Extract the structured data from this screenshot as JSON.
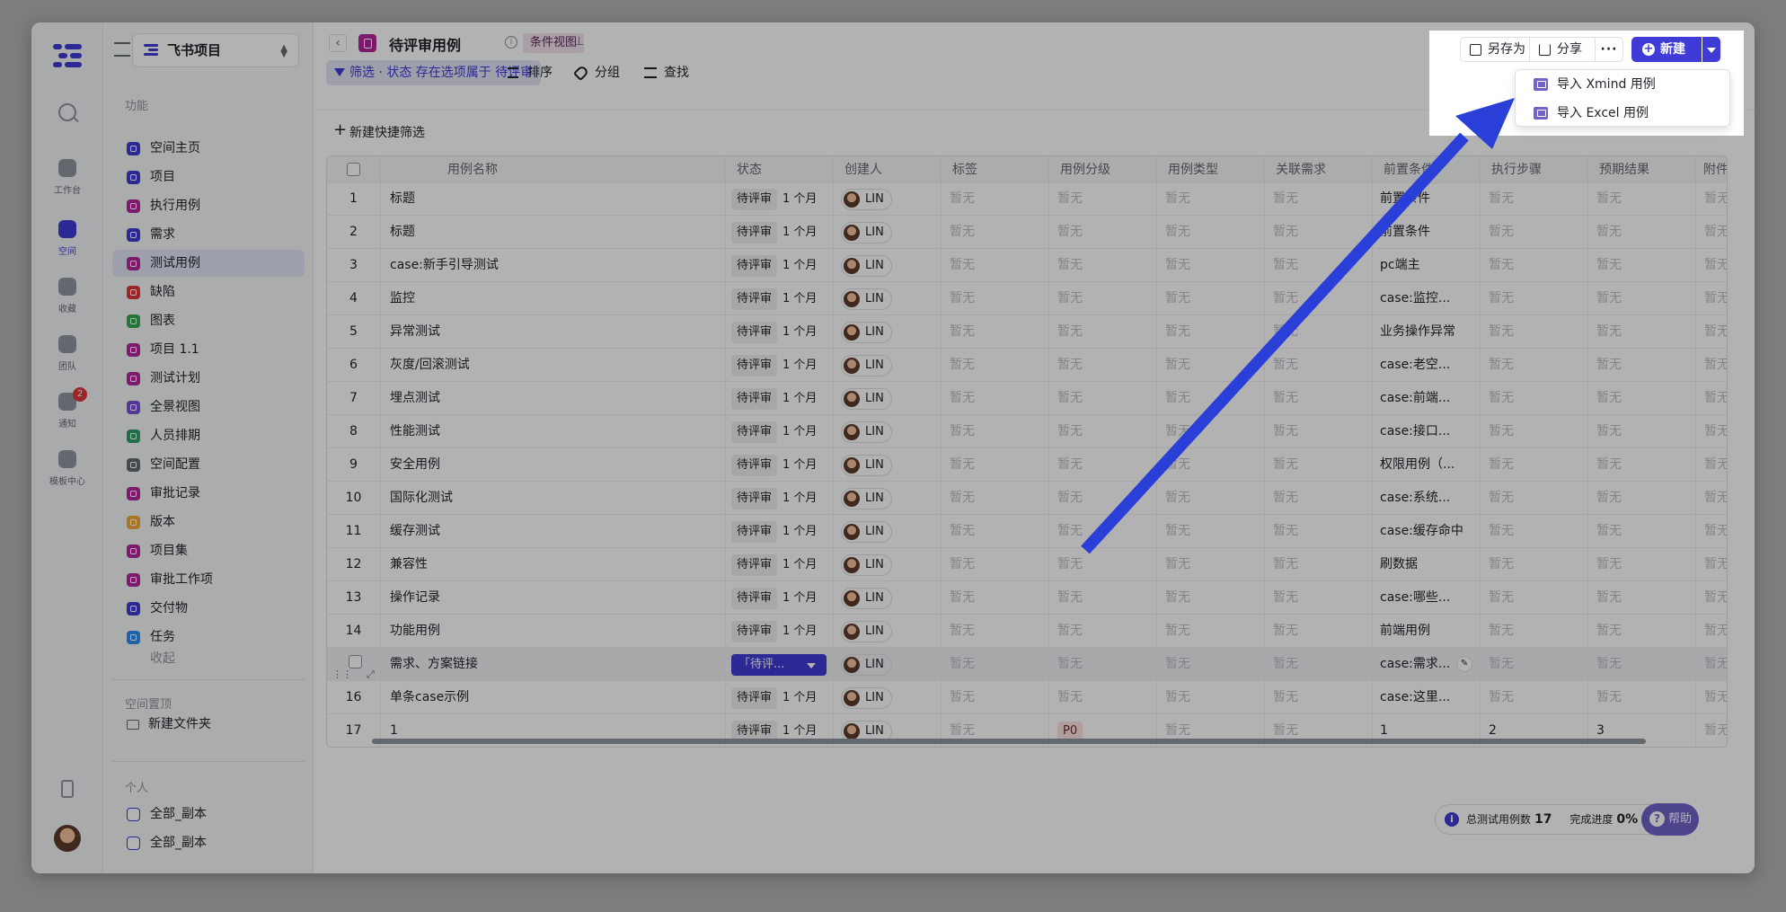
{
  "window": {
    "title": "待评审用例"
  },
  "rail": {
    "items": [
      {
        "label": "工作台"
      },
      {
        "label": "空间"
      },
      {
        "label": "收藏"
      },
      {
        "label": "团队"
      },
      {
        "label": "通知",
        "badge": "2"
      },
      {
        "label": "模板中心"
      }
    ]
  },
  "sidebar": {
    "project": "飞书项目",
    "section_features": "功能",
    "items": [
      {
        "label": "空间主页",
        "color": "#3f3bd6"
      },
      {
        "label": "项目",
        "color": "#3f3bd6"
      },
      {
        "label": "执行用例",
        "color": "#b3269b"
      },
      {
        "label": "需求",
        "color": "#3f3bd6"
      },
      {
        "label": "测试用例",
        "color": "#b3269b"
      },
      {
        "label": "缺陷",
        "color": "#e0353a"
      },
      {
        "label": "图表",
        "color": "#34a853"
      },
      {
        "label": "项目 1.1",
        "color": "#b3269b"
      },
      {
        "label": "测试计划",
        "color": "#b3269b"
      },
      {
        "label": "全景视图",
        "color": "#7a4fd6"
      },
      {
        "label": "人员排期",
        "color": "#2e9e6b"
      },
      {
        "label": "空间配置",
        "color": "#646a73"
      },
      {
        "label": "审批记录",
        "color": "#b3269b"
      },
      {
        "label": "版本",
        "color": "#f2a93b"
      },
      {
        "label": "项目集",
        "color": "#b3269b"
      },
      {
        "label": "审批工作项",
        "color": "#b3269b"
      },
      {
        "label": "交付物",
        "color": "#3f3bd6"
      },
      {
        "label": "任务",
        "color": "#2d8cf0"
      }
    ],
    "collapse": "收起",
    "section_pinned": "空间置顶",
    "new_folder": "新建文件夹",
    "section_personal": "个人",
    "personal_items": [
      {
        "label": "全部_副本"
      },
      {
        "label": "全部_副本"
      }
    ]
  },
  "header": {
    "title": "待评审用例",
    "view_tag": "条件视图",
    "save_as": "另存为",
    "share": "分享",
    "more": "···",
    "new": "新建"
  },
  "dropdown": {
    "items": [
      {
        "label": "导入 Xmind 用例"
      },
      {
        "label": "导入 Excel 用例"
      }
    ]
  },
  "toolbar": {
    "filter": "筛选 · 状态 存在选项属于 待评审",
    "sort": "排序",
    "group": "分组",
    "find": "查找",
    "quick_filter": "新建快捷筛选"
  },
  "table": {
    "columns": [
      "用例名称",
      "状态",
      "创建人",
      "标签",
      "用例分级",
      "用例类型",
      "关联需求",
      "前置条件",
      "执行步骤",
      "预期结果",
      "附件"
    ],
    "empty": "暂无",
    "status": "待评审",
    "status_dropdown": "「待评...",
    "time": "1 个月",
    "creator": "LIN",
    "rows": [
      {
        "no": "1",
        "name": "标题",
        "pre": "前置条件"
      },
      {
        "no": "2",
        "name": "标题",
        "pre": "前置条件"
      },
      {
        "no": "3",
        "name": "case:新手引导测试",
        "pre": "pc端主"
      },
      {
        "no": "4",
        "name": "监控",
        "pre": "case:监控..."
      },
      {
        "no": "5",
        "name": "异常测试",
        "pre": "业务操作异常"
      },
      {
        "no": "6",
        "name": "灰度/回滚测试",
        "pre": "case:老空..."
      },
      {
        "no": "7",
        "name": "埋点测试",
        "pre": "case:前端..."
      },
      {
        "no": "8",
        "name": "性能测试",
        "pre": "case:接口..."
      },
      {
        "no": "9",
        "name": "安全用例",
        "pre": "权限用例（..."
      },
      {
        "no": "10",
        "name": "国际化测试",
        "pre": "case:系统..."
      },
      {
        "no": "11",
        "name": "缓存测试",
        "pre": "case:缓存命中"
      },
      {
        "no": "12",
        "name": "兼容性",
        "pre": "刷数据"
      },
      {
        "no": "13",
        "name": "操作记录",
        "pre": "case:哪些..."
      },
      {
        "no": "14",
        "name": "功能用例",
        "pre": "前端用例"
      },
      {
        "no": "",
        "name": "需求、方案链接",
        "pre": "case:需求..."
      },
      {
        "no": "16",
        "name": "单条case示例",
        "pre": "case:这里..."
      },
      {
        "no": "17",
        "name": "1",
        "level": "P0",
        "pre": "1",
        "step": "2",
        "expected": "3"
      }
    ]
  },
  "footer": {
    "total_label": "总测试用例数",
    "total_value": "17",
    "progress_label": "完成进度",
    "progress_value": "0%",
    "help": "帮助"
  },
  "colors": {
    "accent": "#3f3bd6",
    "arrow": "#2a3ed8"
  }
}
